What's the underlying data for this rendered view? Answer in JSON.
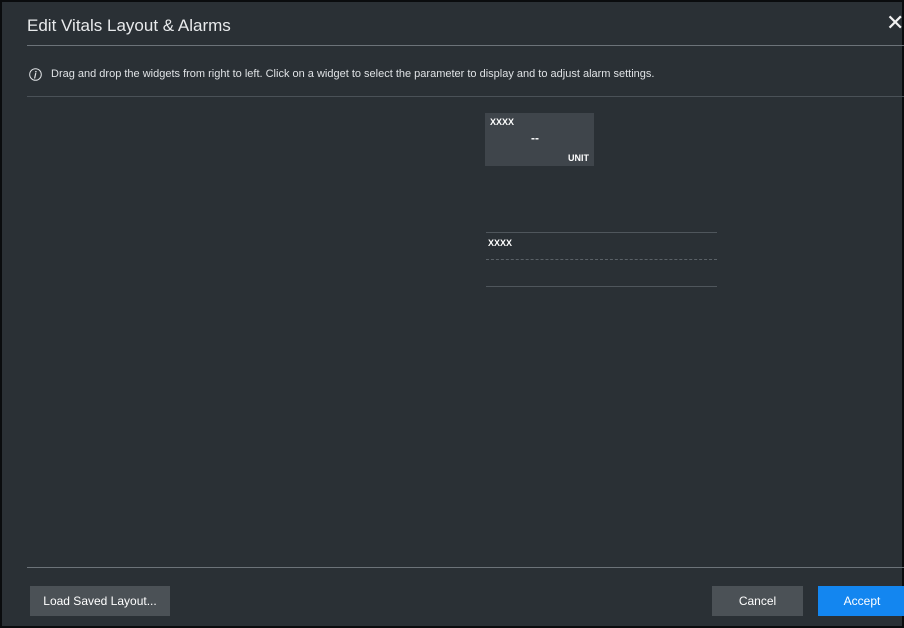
{
  "dialog": {
    "title": "Edit Vitals Layout & Alarms",
    "close_glyph": "✕",
    "info_icon": "info-icon",
    "info_text": "Drag and drop the widgets from right to left. Click on a widget to select the parameter to display and to adjust alarm settings."
  },
  "widgets": {
    "numeric": {
      "label": "XXXX",
      "value": "--",
      "unit": "UNIT"
    },
    "waveform": {
      "label": "XXXX"
    }
  },
  "footer": {
    "load_label": "Load Saved Layout...",
    "cancel_label": "Cancel",
    "accept_label": "Accept"
  },
  "colors": {
    "background": "#2a3035",
    "tile": "#3f454b",
    "button": "#4b5156",
    "accent": "#1386f0"
  }
}
